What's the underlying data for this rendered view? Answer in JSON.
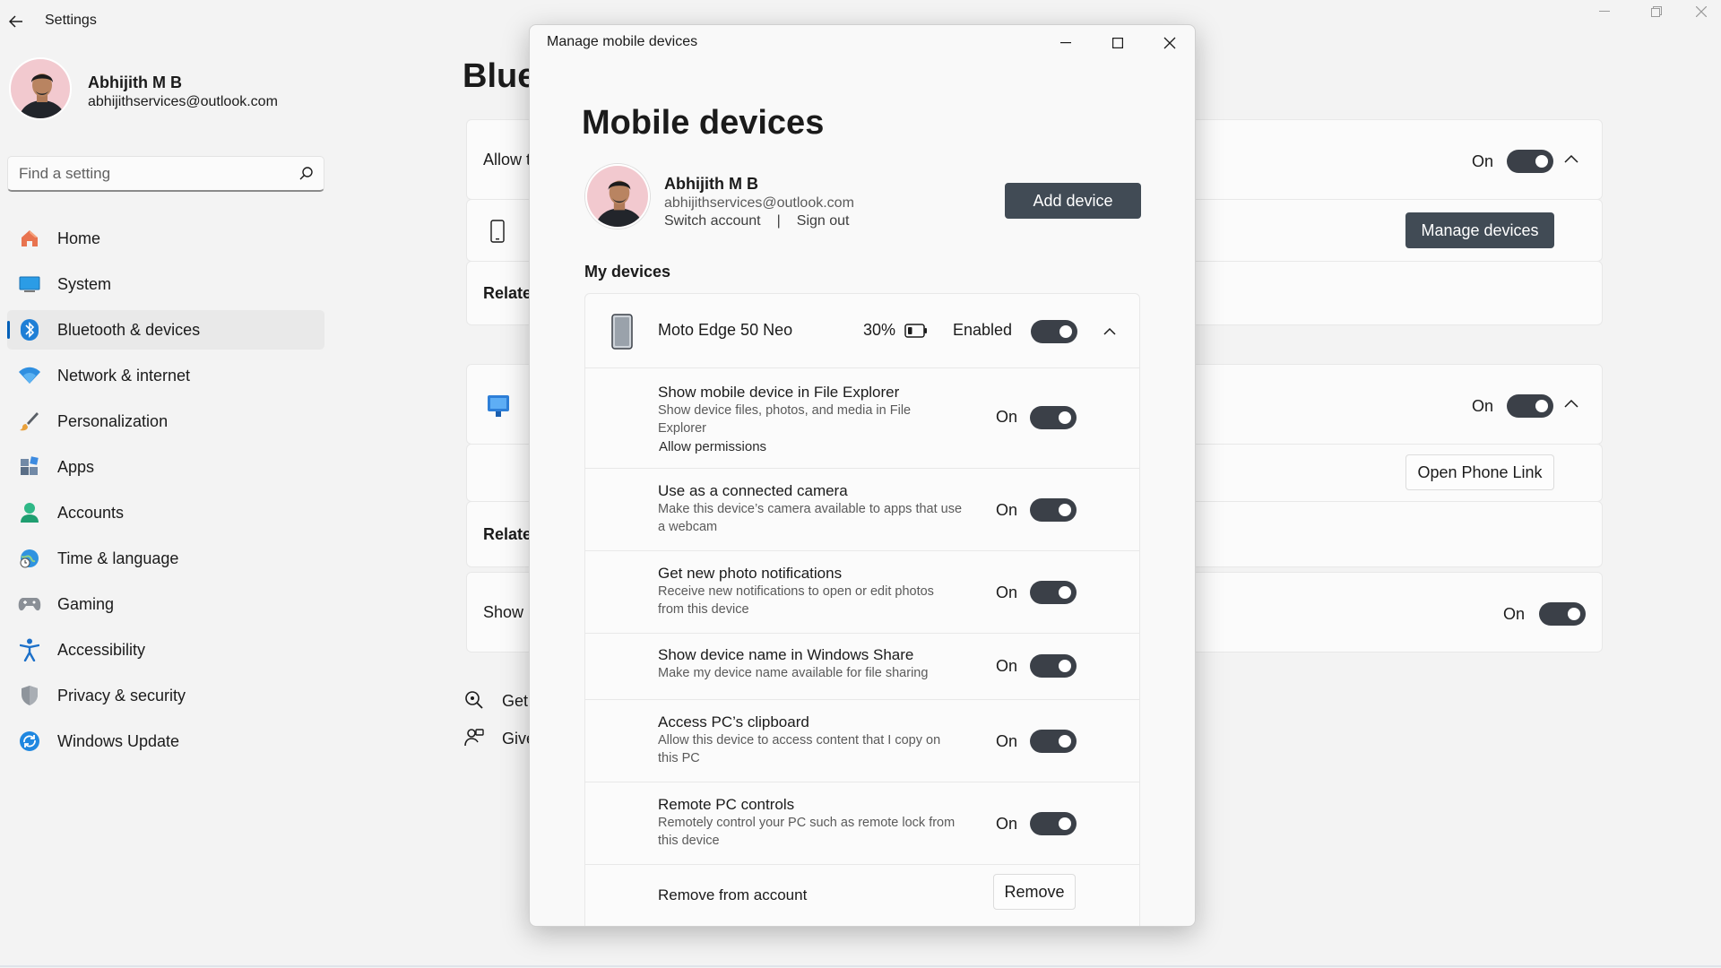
{
  "window": {
    "app_title": "Settings"
  },
  "profile": {
    "name": "Abhijith M B",
    "email": "abhijithservices@outlook.com"
  },
  "search": {
    "placeholder": "Find a setting"
  },
  "nav": {
    "active": "Bluetooth & devices",
    "items": [
      {
        "label": "Home",
        "icon": "home-icon"
      },
      {
        "label": "System",
        "icon": "system-icon"
      },
      {
        "label": "Bluetooth & devices",
        "icon": "bluetooth-icon"
      },
      {
        "label": "Network & internet",
        "icon": "wifi-icon"
      },
      {
        "label": "Personalization",
        "icon": "brush-icon"
      },
      {
        "label": "Apps",
        "icon": "apps-icon"
      },
      {
        "label": "Accounts",
        "icon": "person-icon"
      },
      {
        "label": "Time & language",
        "icon": "globe-clock-icon"
      },
      {
        "label": "Gaming",
        "icon": "gamepad-icon"
      },
      {
        "label": "Accessibility",
        "icon": "accessibility-icon"
      },
      {
        "label": "Privacy & security",
        "icon": "shield-icon"
      },
      {
        "label": "Windows Update",
        "icon": "update-icon"
      }
    ]
  },
  "background_page": {
    "title_visible": "Blue",
    "card1_text": "Allow t",
    "card1_state": "On",
    "manage_devices_label": "Manage devices",
    "related1_text": "Relate",
    "card2_state": "On",
    "open_phone_link_label": "Open Phone Link",
    "related2_text": "Relate",
    "card3_text": "Show m",
    "card3_state": "On",
    "footer_get": "Get",
    "footer_give": "Give"
  },
  "dialog": {
    "title": "Manage mobile devices",
    "heading": "Mobile devices",
    "account": {
      "name": "Abhijith M B",
      "email": "abhijithservices@outlook.com",
      "switch_label": "Switch account",
      "separator": "|",
      "signout_label": "Sign out"
    },
    "add_device_label": "Add device",
    "section_title": "My devices",
    "device": {
      "name": "Moto Edge 50 Neo",
      "battery": "30%",
      "battery_level": 0.3,
      "status": "Enabled"
    },
    "settings": [
      {
        "title": "Show mobile device in File Explorer",
        "desc": "Show device files, photos, and media in File Explorer",
        "link": "Allow permissions",
        "state": "On"
      },
      {
        "title": "Use as a connected camera",
        "desc": "Make this device’s camera available to apps that use a webcam",
        "state": "On"
      },
      {
        "title": "Get new photo notifications",
        "desc": "Receive new notifications to open or edit photos from this device",
        "state": "On"
      },
      {
        "title": "Show device name in Windows Share",
        "desc": "Make my device name available for file sharing",
        "state": "On"
      },
      {
        "title": "Access PC’s clipboard",
        "desc": "Allow this device to access content that I copy on this PC",
        "state": "On"
      },
      {
        "title": "Remote PC controls",
        "desc": "Remotely control your PC such as remote lock from this device",
        "state": "On"
      }
    ],
    "remove": {
      "title": "Remove from account",
      "button_label": "Remove"
    }
  },
  "colors": {
    "accent": "#005fb8",
    "toggle_on": "#3b4048",
    "primary_button": "#414b55"
  }
}
